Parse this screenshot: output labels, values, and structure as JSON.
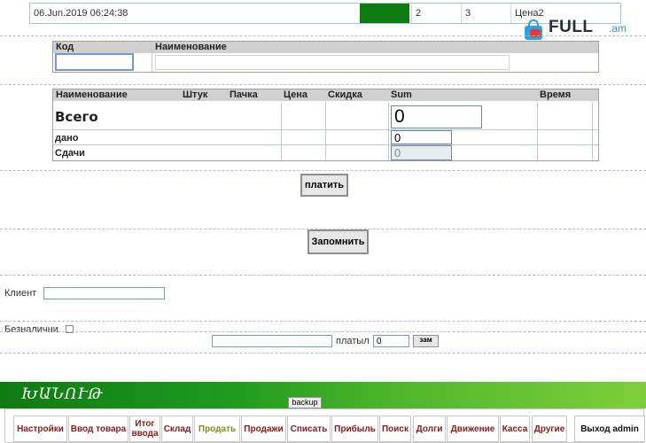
{
  "topbar": {
    "datetime": "06.Jun.2019 06:24:38",
    "col_a": "2",
    "col_b": "3",
    "col_c": "Цена2"
  },
  "watermark": {
    "brand": "FULL",
    "domain": ".am"
  },
  "search": {
    "code_label": "Код",
    "name_label": "Наименование",
    "code_value": "",
    "name_value": ""
  },
  "table": {
    "headers": [
      "Наименование",
      "Штук",
      "Пачка",
      "Цена",
      "Скидка",
      "Sum",
      "Время"
    ],
    "total_label": "Всего",
    "total_value": "0",
    "given_label": "дано",
    "given_value": "0",
    "change_label": "Сдачи",
    "change_value": "0"
  },
  "buttons": {
    "pay": "платить",
    "remember": "Запомнить",
    "zam": "зам",
    "backup": "backup"
  },
  "client": {
    "label": "Клиент",
    "value": ""
  },
  "cashless": {
    "label": "Безналични"
  },
  "payer": {
    "label": "платыл",
    "value": "0",
    "input_value": ""
  },
  "banner": {
    "title": "ԽԱՆՈՒԹ"
  },
  "nav": {
    "items": [
      {
        "label": "Настройки",
        "color": "#8b1a1a"
      },
      {
        "label": "Ввод товара",
        "color": "#8b1a1a"
      },
      {
        "label": "Итог ввода",
        "color": "#8b1a1a"
      },
      {
        "label": "Склад",
        "color": "#8b1a1a"
      },
      {
        "label": "Продать",
        "color": "#8b8b1a"
      },
      {
        "label": "Продажи",
        "color": "#8b1a1a"
      },
      {
        "label": "Списать",
        "color": "#8b1a1a"
      },
      {
        "label": "Прибыль",
        "color": "#8b1a1a"
      },
      {
        "label": "Поиск",
        "color": "#8b1a1a"
      },
      {
        "label": "Долги",
        "color": "#8b1a1a"
      },
      {
        "label": "Движение",
        "color": "#8b1a1a"
      },
      {
        "label": "Касса",
        "color": "#8b1a1a"
      },
      {
        "label": "Другие",
        "color": "#8b1a1a"
      },
      {
        "label": "Выход admin",
        "color": "#111111"
      }
    ]
  }
}
